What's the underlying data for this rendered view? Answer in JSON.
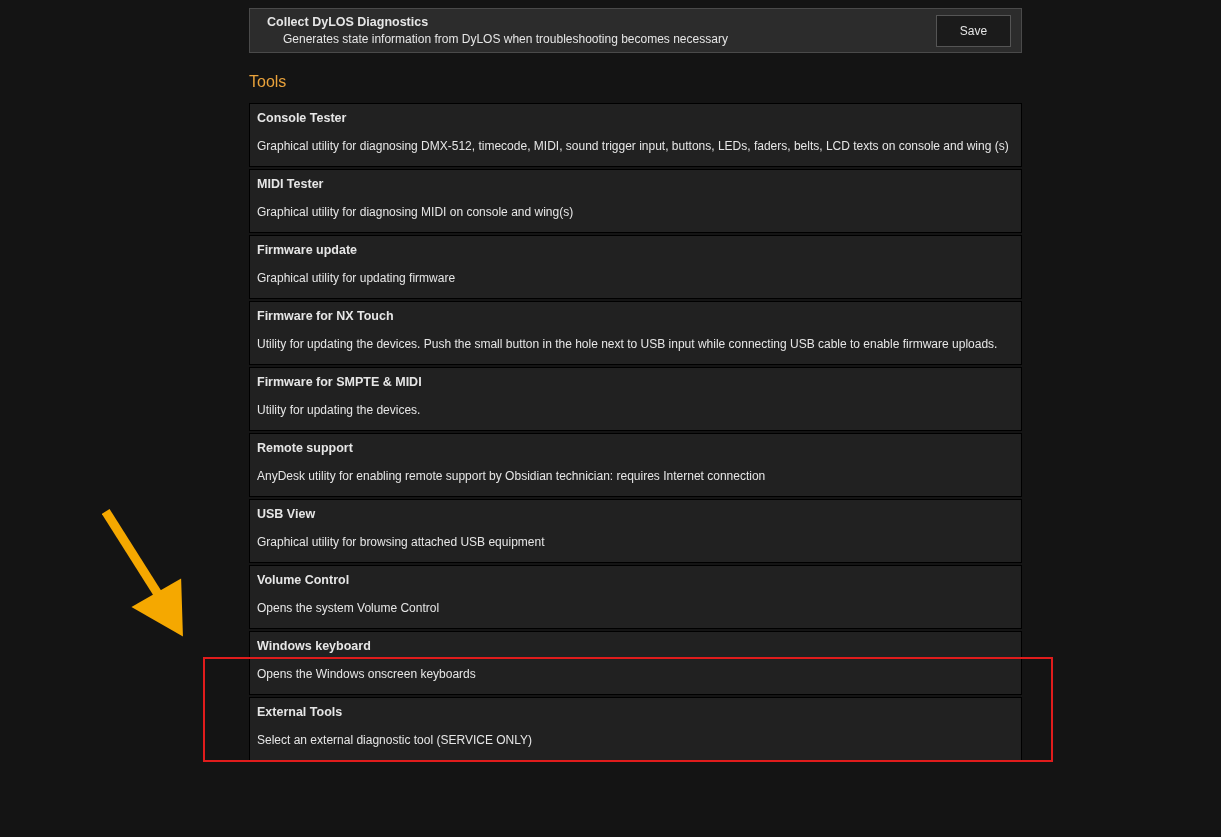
{
  "diagnostics": {
    "title": "Collect DyLOS Diagnostics",
    "description": "Generates state information from DyLOS when troubleshooting becomes necessary",
    "button": "Save"
  },
  "section_title": "Tools",
  "tools": [
    {
      "title": "Console Tester",
      "description": "Graphical utility for diagnosing DMX-512, timecode, MIDI, sound trigger input, buttons, LEDs, faders, belts, LCD texts on console and wing (s)"
    },
    {
      "title": "MIDI Tester",
      "description": "Graphical utility for diagnosing MIDI on console and wing(s)"
    },
    {
      "title": "Firmware update",
      "description": "Graphical utility for updating firmware"
    },
    {
      "title": "Firmware for NX Touch",
      "description": "Utility for updating the devices. Push the small button in the hole next to USB input while connecting USB cable to enable firmware uploads."
    },
    {
      "title": "Firmware for SMPTE & MIDI",
      "description": "Utility for updating the devices."
    },
    {
      "title": "Remote support",
      "description": "AnyDesk utility for enabling remote support by Obsidian technician: requires Internet connection"
    },
    {
      "title": "USB View",
      "description": "Graphical utility for browsing attached USB equipment"
    },
    {
      "title": "Volume Control",
      "description": "Opens the system Volume Control"
    },
    {
      "title": "Windows keyboard",
      "description": "Opens the Windows onscreen keyboards"
    },
    {
      "title": "External Tools",
      "description": "Select an external diagnostic tool (SERVICE ONLY)"
    }
  ]
}
